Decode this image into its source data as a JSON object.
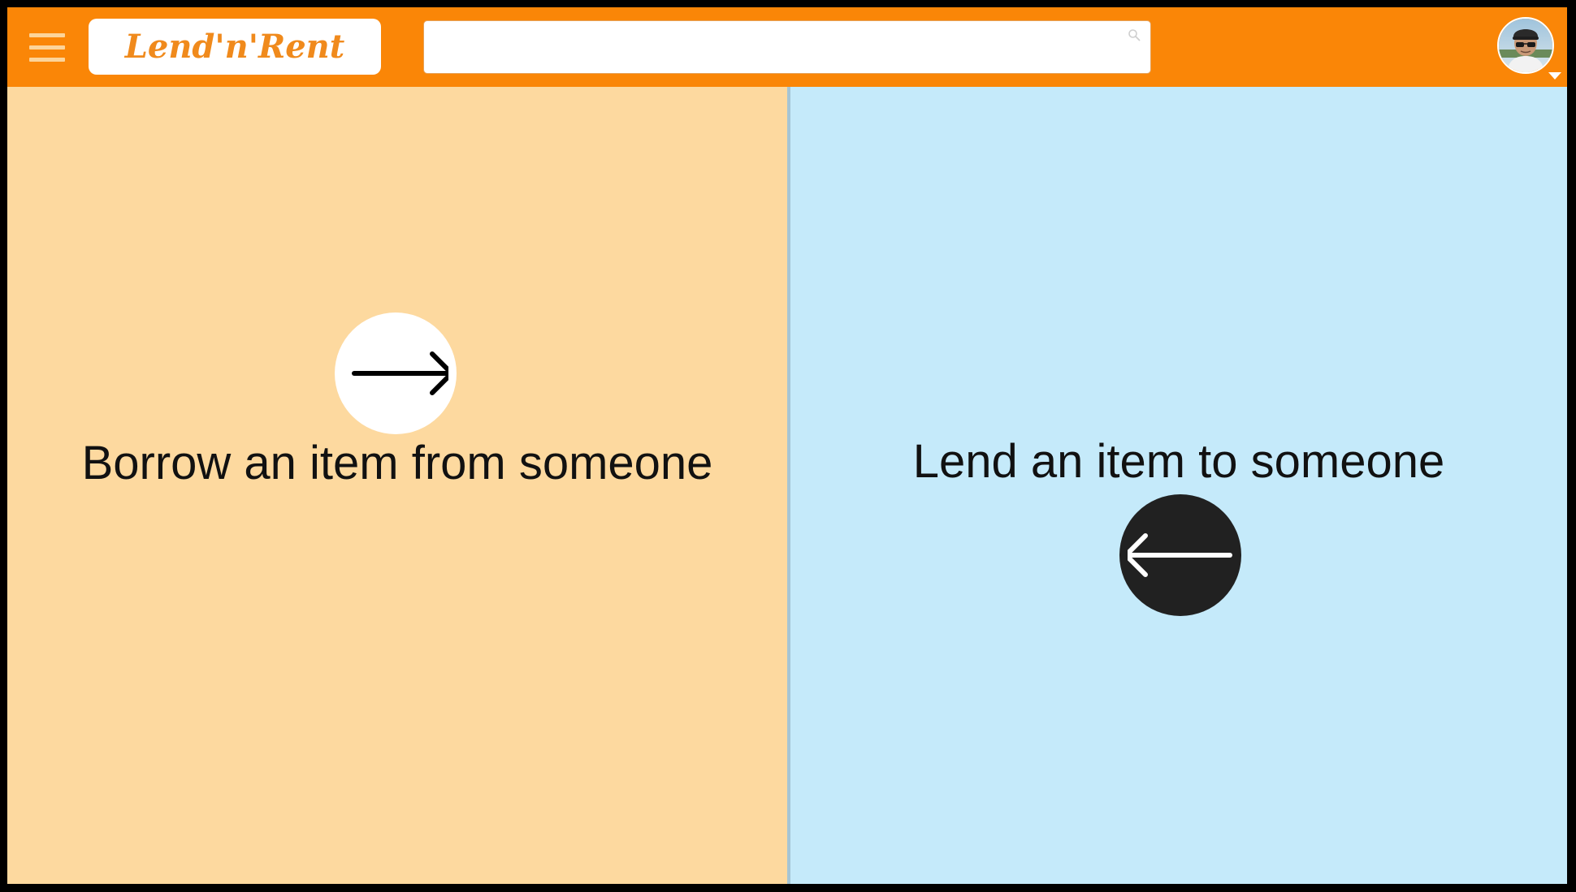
{
  "header": {
    "background_color": "#fa8607",
    "menu_icon": "hamburger-menu-icon",
    "logo_text": "Lend'n'Rent",
    "logo_color": "#f08a1c",
    "search": {
      "value": "",
      "placeholder": "",
      "icon": "search-icon"
    },
    "avatar_icon": "user-avatar",
    "avatar_dropdown_icon": "caret-down-icon"
  },
  "panels": {
    "borrow": {
      "label": "Borrow an item from someone",
      "icon": "arrow-right-icon",
      "background_color": "#fdd99f",
      "button_color": "#ffffff"
    },
    "lend": {
      "label": "Lend an item to someone",
      "icon": "arrow-left-icon",
      "background_color": "#c5eafa",
      "button_color": "#212121"
    }
  }
}
